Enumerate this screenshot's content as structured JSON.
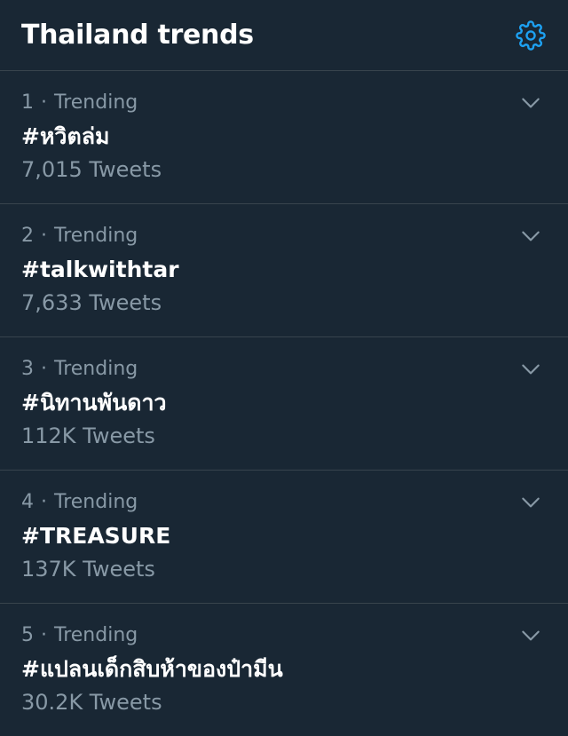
{
  "header": {
    "title": "Thailand trends",
    "settings_icon": "gear-icon"
  },
  "colors": {
    "background": "#192734",
    "divider": "#38444d",
    "accent": "#1da1f2",
    "secondary_text": "#8899a6",
    "primary_text": "#ffffff"
  },
  "trends": [
    {
      "rank": "1",
      "separator": "·",
      "context": "Trending",
      "name": "#หวิตล่ม",
      "count": "7,015 Tweets"
    },
    {
      "rank": "2",
      "separator": "·",
      "context": "Trending",
      "name": "#talkwithtar",
      "count": "7,633 Tweets"
    },
    {
      "rank": "3",
      "separator": "·",
      "context": "Trending",
      "name": "#นิทานพันดาว",
      "count": "112K Tweets"
    },
    {
      "rank": "4",
      "separator": "·",
      "context": "Trending",
      "name": "#TREASURE",
      "count": "137K Tweets"
    },
    {
      "rank": "5",
      "separator": "·",
      "context": "Trending",
      "name": "#แปลนเด็กสิบห้าของป๋ามีน",
      "count": "30.2K Tweets"
    }
  ]
}
